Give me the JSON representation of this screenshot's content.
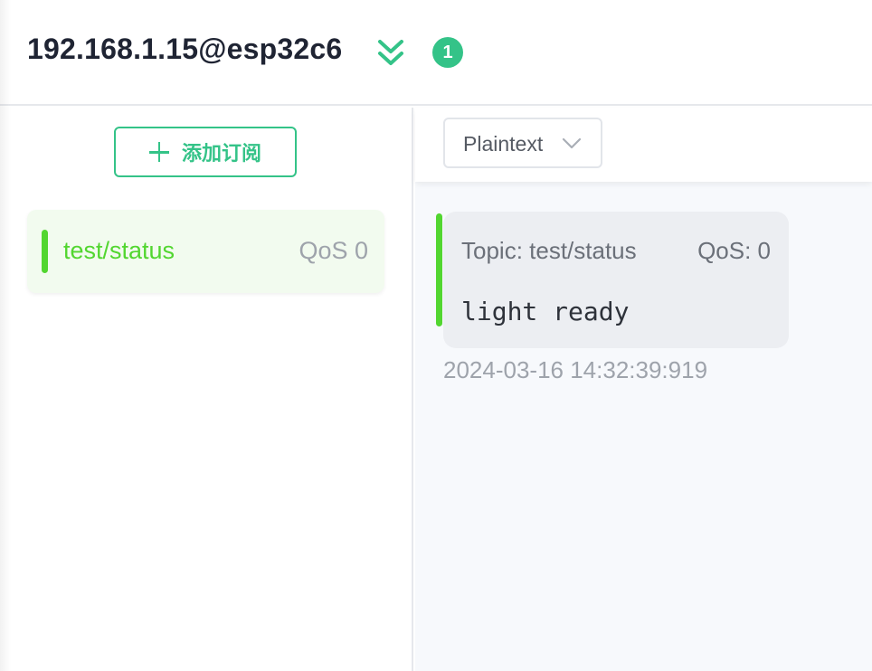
{
  "header": {
    "connection_title": "192.168.1.15@esp32c6",
    "unread_count": "1",
    "badge_color": "#34c388",
    "collapse_icon": "double-chevron-down-icon"
  },
  "subscriptions": {
    "add_button_label": "添加订阅",
    "items": [
      {
        "topic": "test/status",
        "qos": "QoS 0",
        "color": "#52d630"
      }
    ]
  },
  "messages": {
    "format_select": {
      "value": "Plaintext"
    },
    "items": [
      {
        "topic_label": "Topic: test/status",
        "qos_label": "QoS: 0",
        "payload": "light ready",
        "time": "2024-03-16 14:32:39:919",
        "color": "#52d630"
      }
    ]
  }
}
